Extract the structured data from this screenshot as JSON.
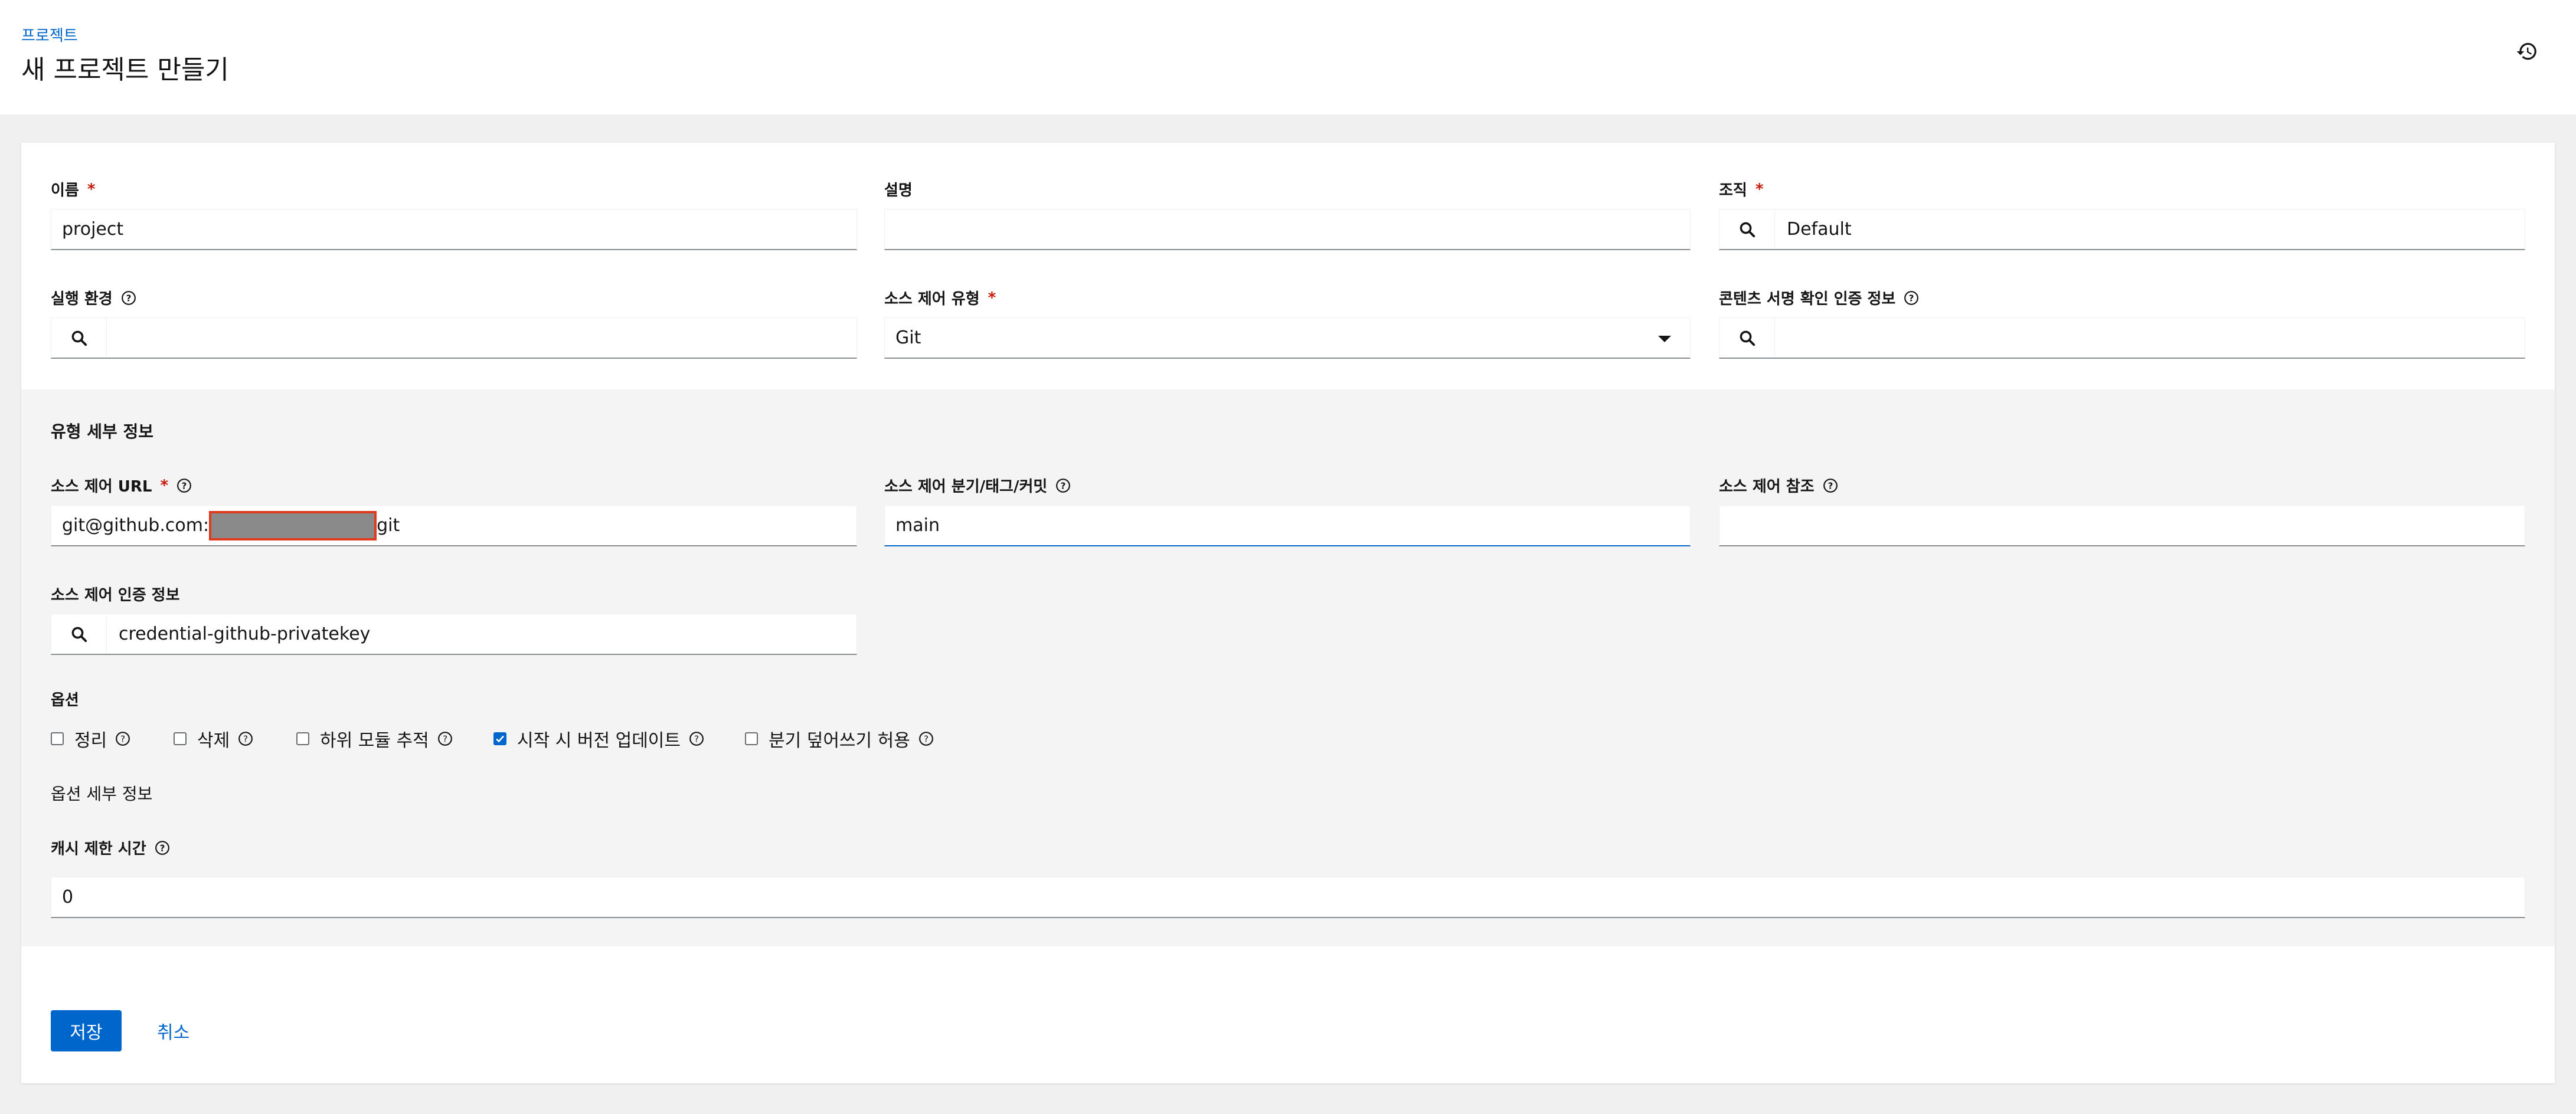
{
  "header": {
    "breadcrumb": "프로젝트",
    "title": "새 프로젝트 만들기",
    "history_icon": "history-icon"
  },
  "form": {
    "name": {
      "label": "이름",
      "required": "*",
      "value": "project"
    },
    "description": {
      "label": "설명",
      "value": ""
    },
    "organization": {
      "label": "조직",
      "required": "*",
      "value": "Default"
    },
    "execution_env": {
      "label": "실행 환경",
      "value": ""
    },
    "scm_type": {
      "label": "소스 제어 유형",
      "required": "*",
      "value": "Git"
    },
    "signature_cred": {
      "label": "콘텐츠 서명 확인 인증 정보",
      "value": ""
    }
  },
  "type_details": {
    "title": "유형 세부 정보",
    "scm_url": {
      "label": "소스 제어 URL",
      "required": "*",
      "value_prefix": "git@github.com:",
      "value_suffix": "git"
    },
    "scm_branch": {
      "label": "소스 제어 분기/태그/커밋",
      "value": "main"
    },
    "scm_refspec": {
      "label": "소스 제어 참조",
      "value": ""
    },
    "scm_credential": {
      "label": "소스 제어 인증 정보",
      "value": "credential-github-privatekey"
    }
  },
  "options": {
    "title": "옵션",
    "items": [
      {
        "label": "정리",
        "checked": false
      },
      {
        "label": "삭제",
        "checked": false
      },
      {
        "label": "하위 모듈 추적",
        "checked": false
      },
      {
        "label": "시작 시 버전 업데이트",
        "checked": true
      },
      {
        "label": "분기 덮어쓰기 허용",
        "checked": false
      }
    ]
  },
  "option_details": {
    "title": "옵션 세부 정보",
    "cache_timeout": {
      "label": "캐시 제한 시간",
      "value": "0"
    }
  },
  "actions": {
    "save": "저장",
    "cancel": "취소"
  },
  "colors": {
    "primary": "#0066cc",
    "required": "#c9190b",
    "redaction_border": "#e03a1e"
  }
}
